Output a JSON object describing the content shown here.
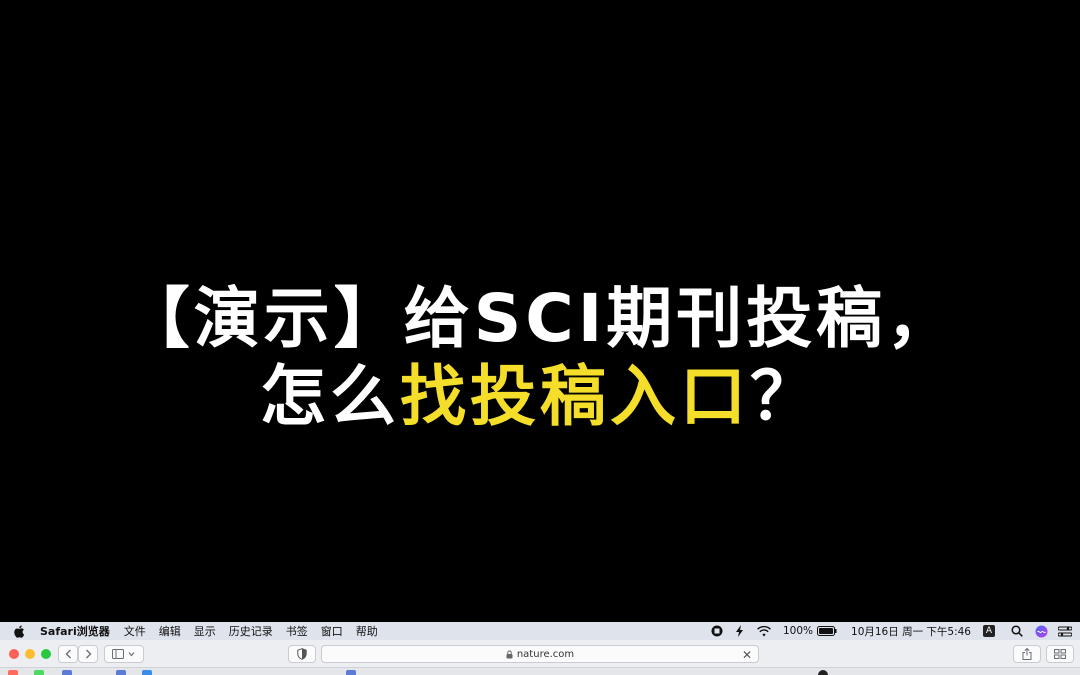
{
  "video_title": {
    "line1": "【演示】给SCI期刊投稿，",
    "line2_prefix": "怎么",
    "line2_highlight": "找投稿入口",
    "line2_suffix": "？"
  },
  "colors": {
    "highlight": "#f4de2a",
    "title_text": "#ffffff",
    "background": "#000000"
  },
  "menubar": {
    "app_name": "Safari浏览器",
    "items": [
      "文件",
      "编辑",
      "显示",
      "历史记录",
      "书签",
      "窗口",
      "帮助"
    ],
    "battery": "100%",
    "datetime": "10月16日 周一 下午5:46",
    "input_method": "A"
  },
  "browser": {
    "url": "nature.com"
  },
  "icons": {
    "apple": "apple-icon",
    "record": "screen-record-icon",
    "bolt": "bolt-icon",
    "wifi": "wifi-icon",
    "battery": "battery-icon",
    "search": "spotlight-search-icon",
    "siri": "siri-icon",
    "control_center": "control-center-icon"
  }
}
